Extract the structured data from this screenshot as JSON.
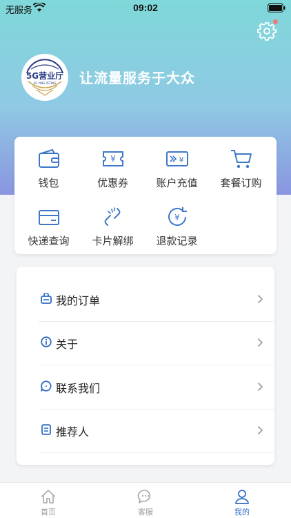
{
  "status_bar": {
    "carrier": "无服务",
    "time": "09:02"
  },
  "header": {
    "slogan": "让流量服务于大众",
    "logo_text": "5G营业厅",
    "logo_subtext": "5G YING YETING"
  },
  "services": [
    {
      "label": "钱包",
      "icon": "wallet-icon"
    },
    {
      "label": "优惠券",
      "icon": "coupon-icon"
    },
    {
      "label": "账户充值",
      "icon": "recharge-icon"
    },
    {
      "label": "套餐订购",
      "icon": "cart-icon"
    },
    {
      "label": "快递查询",
      "icon": "parcel-icon"
    },
    {
      "label": "卡片解绑",
      "icon": "unlink-icon"
    },
    {
      "label": "退款记录",
      "icon": "refund-icon"
    }
  ],
  "menu": [
    {
      "label": "我的订单",
      "icon": "order-icon"
    },
    {
      "label": "关于",
      "icon": "info-icon"
    },
    {
      "label": "联系我们",
      "icon": "chat-bubble-icon"
    },
    {
      "label": "推荐人",
      "icon": "referrer-icon"
    }
  ],
  "tabbar": [
    {
      "label": "首页",
      "icon": "home-icon"
    },
    {
      "label": "客服",
      "icon": "customer-service-icon"
    },
    {
      "label": "我的",
      "icon": "user-icon",
      "active": true
    }
  ],
  "colors": {
    "accent": "#2f6cc4",
    "icon_blue": "#3d78c9",
    "hero_top": "#7fd8d9",
    "hero_bottom": "#8a95e0"
  }
}
